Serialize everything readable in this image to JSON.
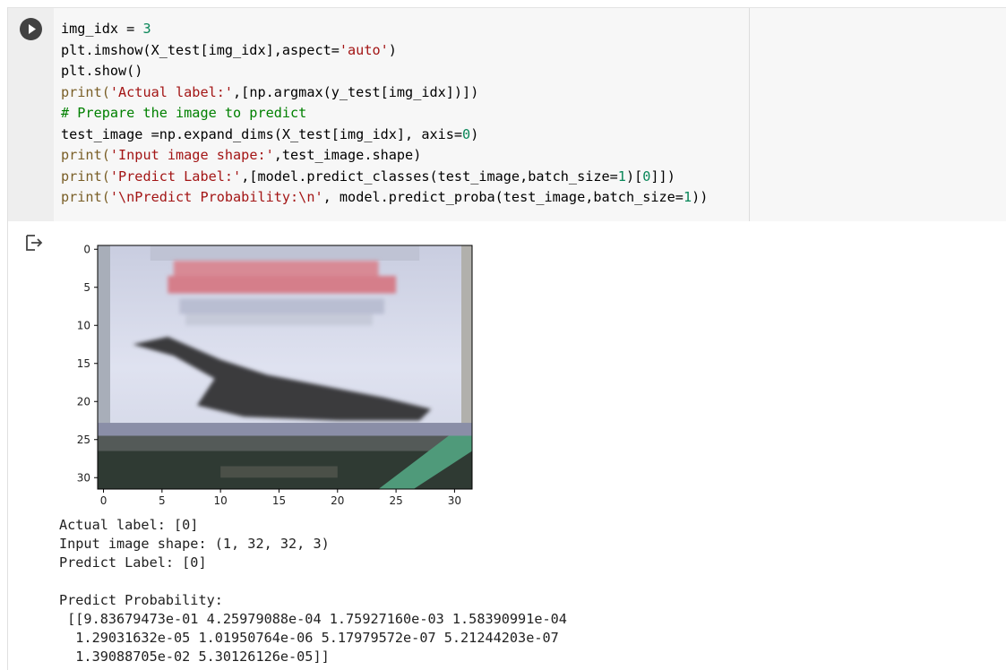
{
  "cell": {
    "run_button_icon": "play-icon",
    "output_icon": "output-redirect-icon",
    "code_lines": [
      [
        {
          "t": "img_idx = ",
          "c": "plain"
        },
        {
          "t": "3",
          "c": "tk-num"
        }
      ],
      [
        {
          "t": "plt.imshow(X_test[img_idx],aspect=",
          "c": "plain"
        },
        {
          "t": "'auto'",
          "c": "tk-str"
        },
        {
          "t": ")",
          "c": "plain"
        }
      ],
      [
        {
          "t": "plt.show()",
          "c": "plain"
        }
      ],
      [
        {
          "t": "print(",
          "c": "tk-fn"
        },
        {
          "t": "'Actual label:'",
          "c": "tk-str"
        },
        {
          "t": ",[np.argmax(y_test[img_idx])])",
          "c": "plain"
        }
      ],
      [
        {
          "t": "# Prepare the image to predict",
          "c": "tk-com"
        }
      ],
      [
        {
          "t": "test_image =np.expand_dims(X_test[img_idx], axis=",
          "c": "plain"
        },
        {
          "t": "0",
          "c": "tk-num"
        },
        {
          "t": ")",
          "c": "plain"
        }
      ],
      [
        {
          "t": "print(",
          "c": "tk-fn"
        },
        {
          "t": "'Input image shape:'",
          "c": "tk-str"
        },
        {
          "t": ",test_image.shape)",
          "c": "plain"
        }
      ],
      [
        {
          "t": "print(",
          "c": "tk-fn"
        },
        {
          "t": "'Predict Label:'",
          "c": "tk-str"
        },
        {
          "t": ",[model.predict_classes(test_image,batch_size=",
          "c": "plain"
        },
        {
          "t": "1",
          "c": "tk-num"
        },
        {
          "t": ")[",
          "c": "plain"
        },
        {
          "t": "0",
          "c": "tk-num"
        },
        {
          "t": "]])",
          "c": "plain"
        }
      ],
      [
        {
          "t": "print(",
          "c": "tk-fn"
        },
        {
          "t": "'\\nPredict Probability:\\n'",
          "c": "tk-str"
        },
        {
          "t": ", model.predict_proba(test_image,batch_size=",
          "c": "plain"
        },
        {
          "t": "1",
          "c": "tk-num"
        },
        {
          "t": "))",
          "c": "plain"
        }
      ]
    ]
  },
  "output": {
    "plot": {
      "type": "imshow",
      "x_ticks": [
        "0",
        "5",
        "10",
        "15",
        "20",
        "25",
        "30"
      ],
      "y_ticks": [
        "0",
        "5",
        "10",
        "15",
        "20",
        "25",
        "30"
      ],
      "x_range": [
        -0.5,
        31.5
      ],
      "y_range": [
        -0.5,
        31.5
      ]
    },
    "stdout_lines": [
      "Actual label: [0]",
      "Input image shape: (1, 32, 32, 3)",
      "Predict Label: [0]",
      "",
      "Predict Probability:",
      " [[9.83679473e-01 4.25979088e-04 1.75927160e-03 1.58390991e-04",
      "  1.29031632e-05 1.01950764e-06 5.17979572e-07 5.21244203e-07",
      "  1.39088705e-02 5.30126126e-05]]"
    ]
  }
}
